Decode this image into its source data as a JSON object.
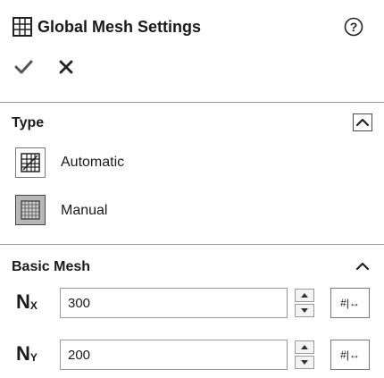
{
  "header": {
    "title": "Global Mesh Settings",
    "icons": {
      "panel": "grid-panel-icon",
      "help": "help-icon"
    }
  },
  "actions": {
    "ok_icon": "checkmark-icon",
    "cancel_icon": "close-icon"
  },
  "type_section": {
    "title": "Type",
    "options": [
      {
        "label": "Automatic",
        "icon": "automatic-mesh-icon",
        "selected": false
      },
      {
        "label": "Manual",
        "icon": "manual-mesh-icon",
        "selected": true
      }
    ]
  },
  "basic_mesh": {
    "title": "Basic Mesh",
    "params": [
      {
        "symbol": "N",
        "subscript": "X",
        "value": "300",
        "lock_label": "#|↔"
      },
      {
        "symbol": "N",
        "subscript": "Y",
        "value": "200",
        "lock_label": "#|↔"
      }
    ]
  },
  "colors": {
    "divider": "#9a9a9a",
    "selected_button": "#b8b8b8"
  }
}
